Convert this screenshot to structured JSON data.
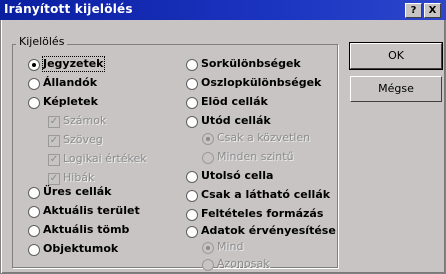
{
  "window": {
    "title": "Irányított kijelölés",
    "help_label": "?",
    "close_label": "X"
  },
  "group": {
    "label": "Kijelölés"
  },
  "left_options": [
    {
      "label": "Jegyzetek",
      "selected": true
    },
    {
      "label": "Állandók"
    },
    {
      "label": "Képletek"
    }
  ],
  "formula_suboptions": [
    {
      "label": "Számok",
      "checked": true
    },
    {
      "label": "Szöveg",
      "checked": true
    },
    {
      "label": "Logikai értékek",
      "checked": true
    },
    {
      "label": "Hibák",
      "checked": true
    }
  ],
  "left_options_2": [
    {
      "label": "Üres cellák"
    },
    {
      "label": "Aktuális terület"
    },
    {
      "label": "Aktuális tömb"
    },
    {
      "label": "Objektumok"
    }
  ],
  "right_options": [
    {
      "label": "Sorkülönbségek"
    },
    {
      "label": "Oszlopkülönbségek"
    },
    {
      "label": "Elõd cellák"
    },
    {
      "label": "Utód cellák"
    }
  ],
  "dependents_suboptions": [
    {
      "label": "Csak a közvetlen",
      "selected": true
    },
    {
      "label": "Minden szintű"
    }
  ],
  "right_options_2": [
    {
      "label": "Utolsó cella"
    },
    {
      "label": "Csak a látható cellák"
    },
    {
      "label": "Feltételes formázás"
    },
    {
      "label": "Adatok érvényesítése"
    }
  ],
  "validation_suboptions": [
    {
      "label": "Mind",
      "selected": true
    },
    {
      "label": "Azonosak"
    }
  ],
  "buttons": {
    "ok": "OK",
    "cancel": "Mégse"
  }
}
